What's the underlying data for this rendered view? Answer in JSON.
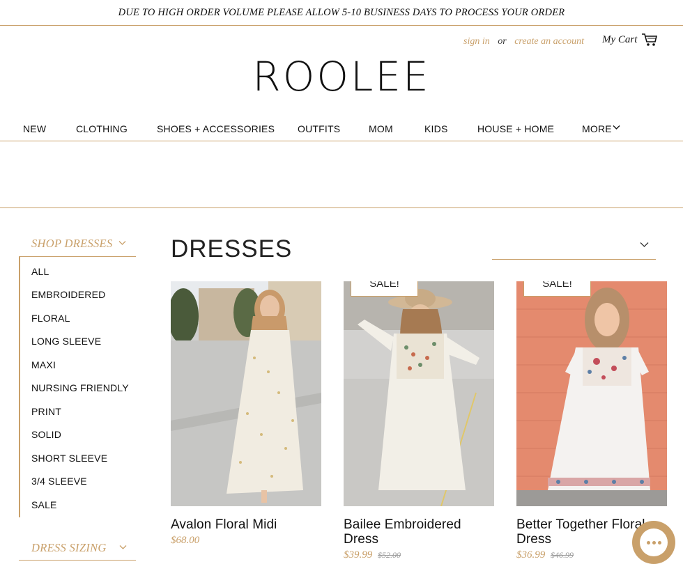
{
  "announcement": "DUE TO HIGH ORDER VOLUME PLEASE ALLOW 5-10 BUSINESS DAYS TO PROCESS YOUR ORDER",
  "account": {
    "sign_in": "sign in",
    "or": "or",
    "create_account": "create an account"
  },
  "cart": {
    "label": "My Cart",
    "icon": "cart-icon"
  },
  "logo": "ROOLEE",
  "nav": [
    "NEW",
    "CLOTHING",
    "SHOES + ACCESSORIES",
    "OUTFITS",
    "MOM",
    "KIDS",
    "HOUSE + HOME",
    "MORE"
  ],
  "sidebar": {
    "heading": "SHOP DRESSES",
    "items": [
      "ALL",
      "EMBROIDERED",
      "FLORAL",
      "LONG SLEEVE",
      "MAXI",
      "NURSING FRIENDLY",
      "PRINT",
      "SOLID",
      "SHORT SLEEVE",
      "3/4 SLEEVE",
      "SALE"
    ],
    "heading2": "DRESS SIZING"
  },
  "main": {
    "title": "DRESSES",
    "sort_value": ""
  },
  "products": [
    {
      "name": "Avalon Floral Midi",
      "price": "$68.00",
      "was": "",
      "badge": ""
    },
    {
      "name": "Bailee Embroidered Dress",
      "price": "$39.99",
      "was": "$52.00",
      "badge": "SALE!"
    },
    {
      "name": "Better Together Floral Dress",
      "price": "$36.99",
      "was": "$46.99",
      "badge": "SALE!"
    }
  ],
  "colors": {
    "accent": "#c9a06a",
    "text": "#111111"
  }
}
